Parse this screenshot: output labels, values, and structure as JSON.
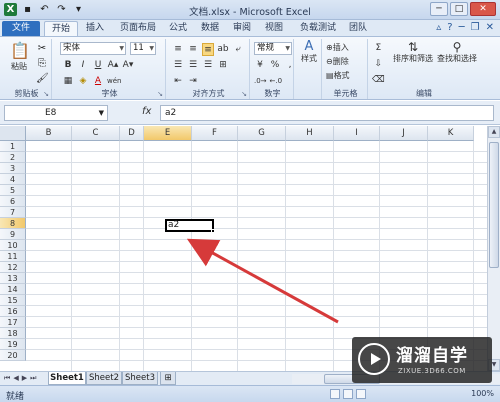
{
  "window": {
    "title": "文档.xlsx - Microsoft Excel",
    "min_label": "─",
    "max_label": "□",
    "close_label": "✕"
  },
  "ribbon_tabs": [
    "文件",
    "开始",
    "插入",
    "页面布局",
    "公式",
    "数据",
    "审阅",
    "视图",
    "负载测试",
    "团队"
  ],
  "ribbon": {
    "clipboard": {
      "label": "剪贴板",
      "paste": "粘贴"
    },
    "font": {
      "label": "字体",
      "name": "宋体",
      "size": "11",
      "bold": "B",
      "italic": "I",
      "underline": "U",
      "font_color_sym": "A",
      "phonetic_sym": "wén"
    },
    "alignment": {
      "label": "对齐方式"
    },
    "number": {
      "label": "数字",
      "format": "常规",
      "percent": "%",
      "comma": ","
    },
    "styles": {
      "label": "样式",
      "button": "样式"
    },
    "cells": {
      "label": "单元格",
      "insert": "插入",
      "delete": "删除",
      "format": "格式"
    },
    "editing": {
      "label": "编辑",
      "sort_filter": "排序和筛选",
      "find_select": "查找和选择",
      "sum": "Σ"
    }
  },
  "formula_bar": {
    "name_box": "E8",
    "fx": "fx",
    "content": "a2"
  },
  "grid": {
    "columns": [
      "B",
      "C",
      "D",
      "E",
      "F",
      "G",
      "H",
      "I",
      "J",
      "K"
    ],
    "rows": [
      "1",
      "2",
      "3",
      "4",
      "5",
      "6",
      "7",
      "8",
      "9",
      "10",
      "11",
      "12",
      "13",
      "14",
      "15",
      "16",
      "17",
      "18",
      "19",
      "20"
    ],
    "selected_col": "E",
    "selected_row": "8",
    "active_cell_value": "a2"
  },
  "sheets": {
    "tabs": [
      "Sheet1",
      "Sheet2",
      "Sheet3"
    ],
    "active": "Sheet1"
  },
  "status": {
    "text": "就绪",
    "zoom": "100%"
  },
  "watermark": {
    "title": "溜溜自学",
    "url": "ZIXUE.3D66.COM"
  },
  "colors": {
    "file_tab": "#2f6fbf",
    "selection_header": "#f2c86a",
    "arrow": "#d63a3a",
    "excel_green": "#1f7a3b"
  }
}
